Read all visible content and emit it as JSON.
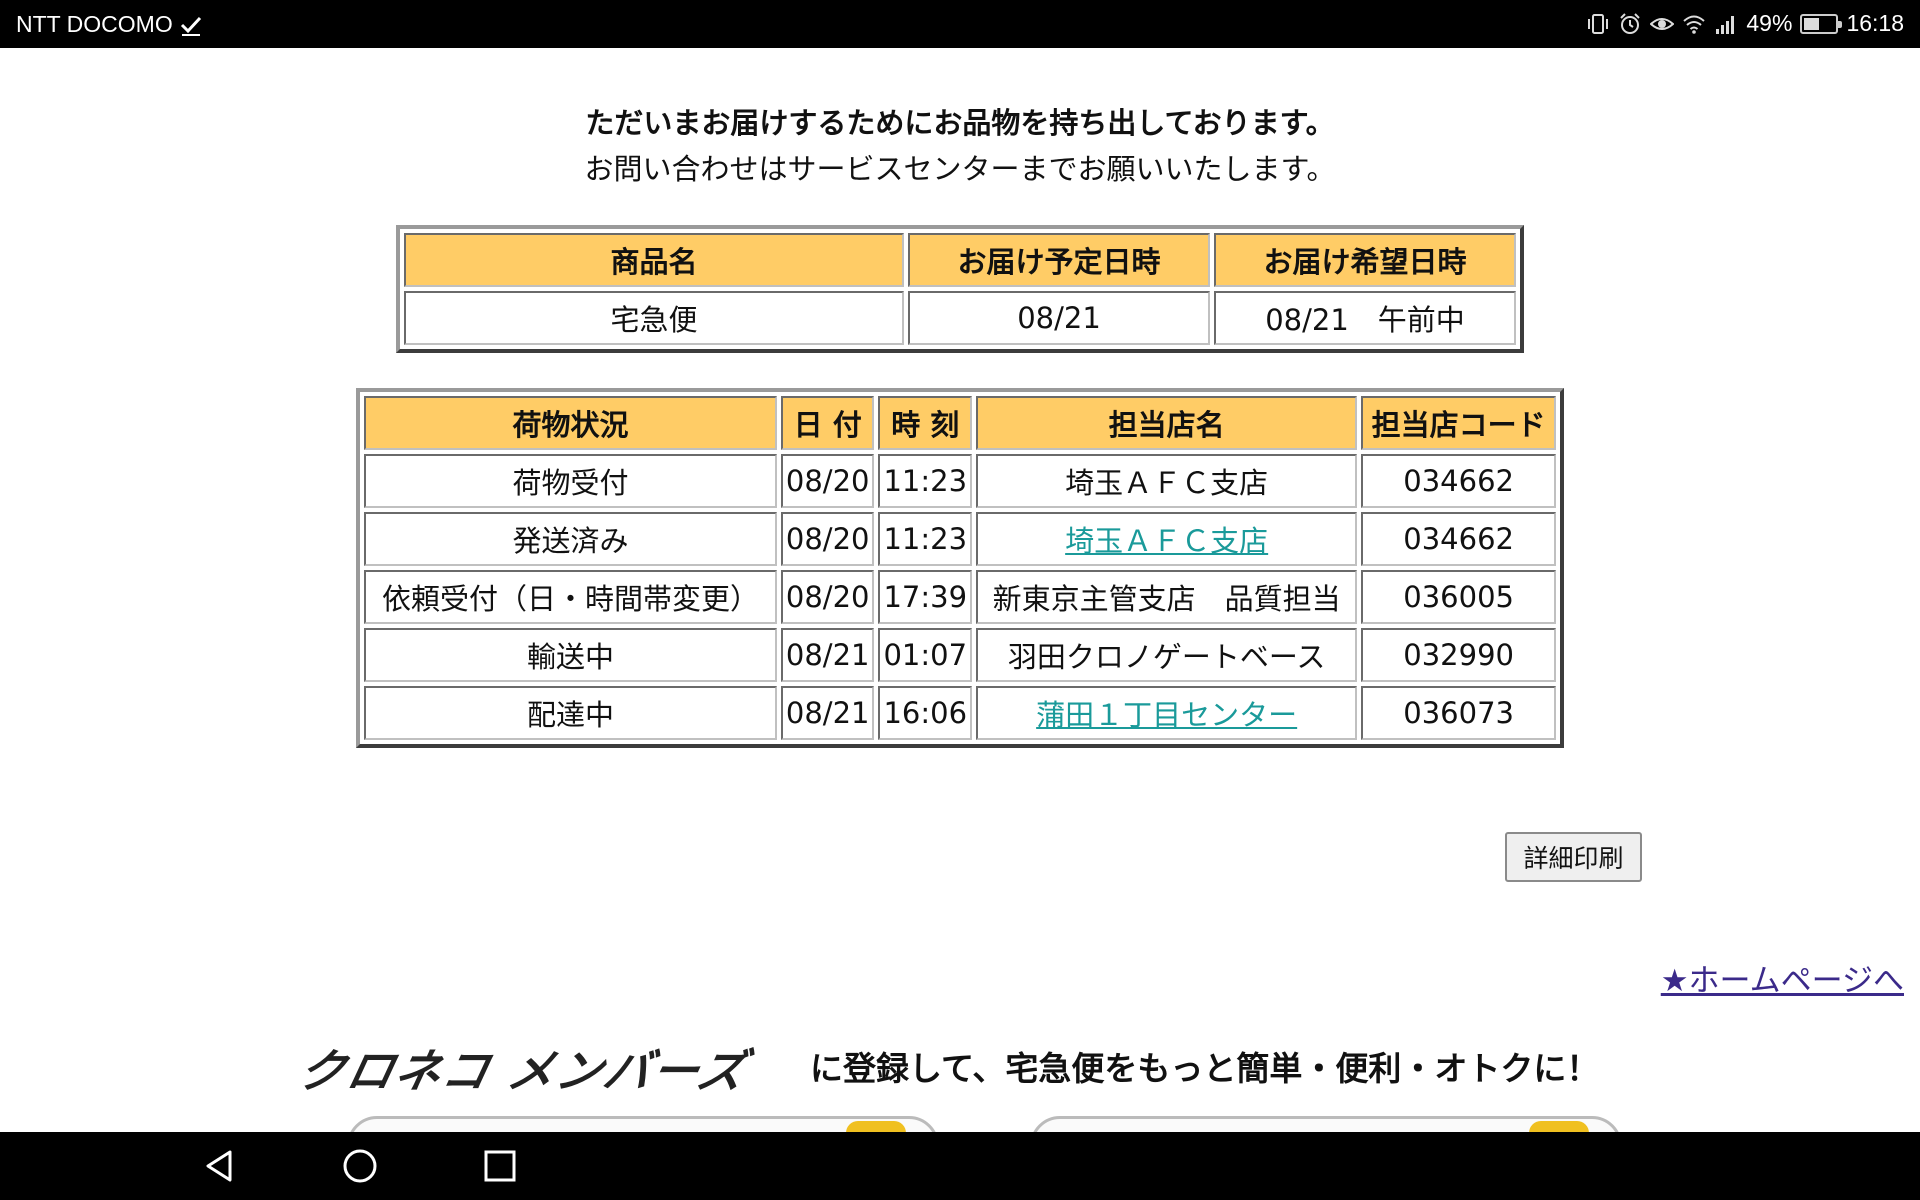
{
  "status_bar": {
    "carrier": "NTT DOCOMO",
    "battery": "49%",
    "battery_level": 0.49,
    "time": "16:18",
    "icons": [
      "check-icon",
      "vibrate-icon",
      "alarm-icon",
      "eye-icon",
      "wifi-icon",
      "signal-icon",
      "battery-icon"
    ]
  },
  "page": {
    "message_bold": "ただいまお届けするためにお品物を持ち出しております。",
    "message": "お問い合わせはサービスセンターまでお願いいたします。"
  },
  "delivery_table": {
    "headers": [
      "商品名",
      "お届け予定日時",
      "お届け希望日時"
    ],
    "row": [
      "宅急便",
      "08/21",
      "08/21　午前中"
    ],
    "header_color": "#ffcc66"
  },
  "tracking_table": {
    "headers": [
      "荷物状況",
      "日 付",
      "時 刻",
      "担当店名",
      "担当店コード"
    ],
    "rows": [
      {
        "status": "荷物受付",
        "date": "08/20",
        "time": "11:23",
        "store": "埼玉ＡＦＣ支店",
        "store_link": false,
        "code": "034662"
      },
      {
        "status": "発送済み",
        "date": "08/20",
        "time": "11:23",
        "store": "埼玉ＡＦＣ支店",
        "store_link": true,
        "code": "034662"
      },
      {
        "status": "依頼受付（日・時間帯変更）",
        "date": "08/20",
        "time": "17:39",
        "store": "新東京主管支店　品質担当",
        "store_link": false,
        "code": "036005"
      },
      {
        "status": "輸送中",
        "date": "08/21",
        "time": "01:07",
        "store": "羽田クロノゲートベース",
        "store_link": false,
        "code": "032990"
      },
      {
        "status": "配達中",
        "date": "08/21",
        "time": "16:06",
        "store": "蒲田１丁目センター",
        "store_link": true,
        "code": "036073"
      }
    ],
    "link_color": "#1a9a9a"
  },
  "actions": {
    "print_label": "詳細印刷",
    "home_link": "★ホームページへ"
  },
  "banner": {
    "logo_text": "クロネコ メンバーズ",
    "text": "に登録して、宅急便をもっと簡単・便利・オトクに！"
  },
  "nav_bar": {
    "icons": [
      "back-icon",
      "home-icon",
      "recents-icon"
    ]
  }
}
